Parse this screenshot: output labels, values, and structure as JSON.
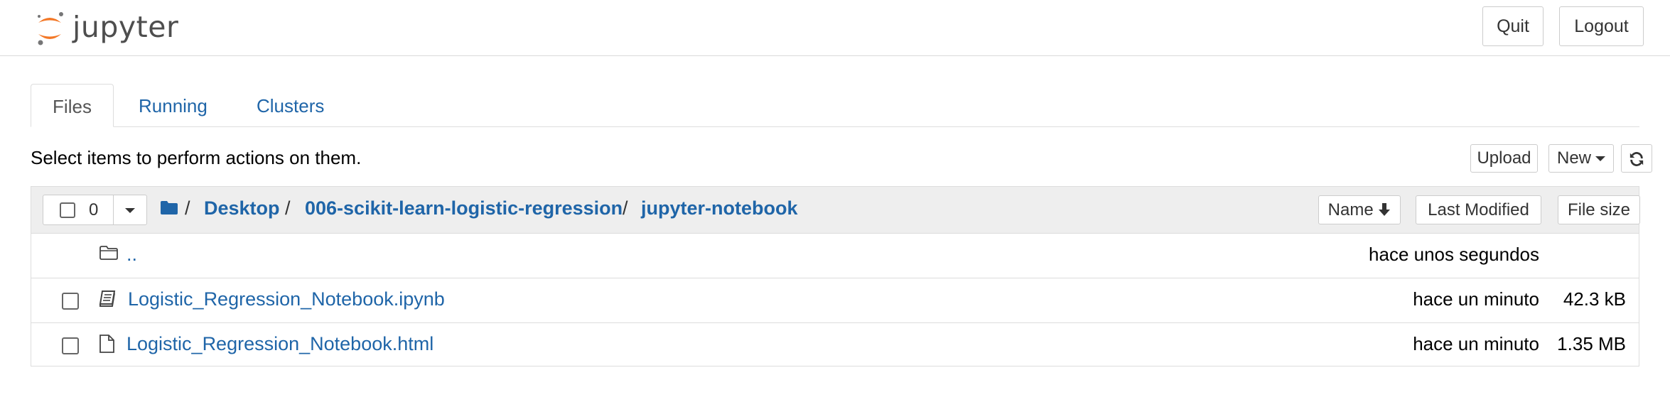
{
  "header": {
    "logo_text": "jupyter",
    "quit_label": "Quit",
    "logout_label": "Logout"
  },
  "tabs": [
    {
      "label": "Files",
      "active": true
    },
    {
      "label": "Running",
      "active": false
    },
    {
      "label": "Clusters",
      "active": false
    }
  ],
  "toolbar": {
    "instruction": "Select items to perform actions on them.",
    "upload_label": "Upload",
    "new_label": "New",
    "refresh_icon": "refresh-icon"
  },
  "list": {
    "selected_count": "0",
    "breadcrumb": {
      "root_sep": "/",
      "items": [
        "Desktop",
        "006-scikit-learn-logistic-regression",
        "jupyter-notebook"
      ],
      "sep": "/"
    },
    "sort": {
      "name_label": "Name",
      "modified_label": "Last Modified",
      "size_label": "File size"
    },
    "rows": [
      {
        "icon": "folder-outline-icon",
        "name": "..",
        "modified": "hace unos segundos",
        "size": "",
        "checkbox": false
      },
      {
        "icon": "notebook-icon",
        "name": "Logistic_Regression_Notebook.ipynb",
        "modified": "hace un minuto",
        "size": "42.3 kB",
        "checkbox": true
      },
      {
        "icon": "file-icon",
        "name": "Logistic_Regression_Notebook.html",
        "modified": "hace un minuto",
        "size": "1.35 MB",
        "checkbox": true
      }
    ]
  },
  "colors": {
    "link": "#1f65a8",
    "logo_orange": "#f37726",
    "header_bg": "#eeeeee"
  }
}
